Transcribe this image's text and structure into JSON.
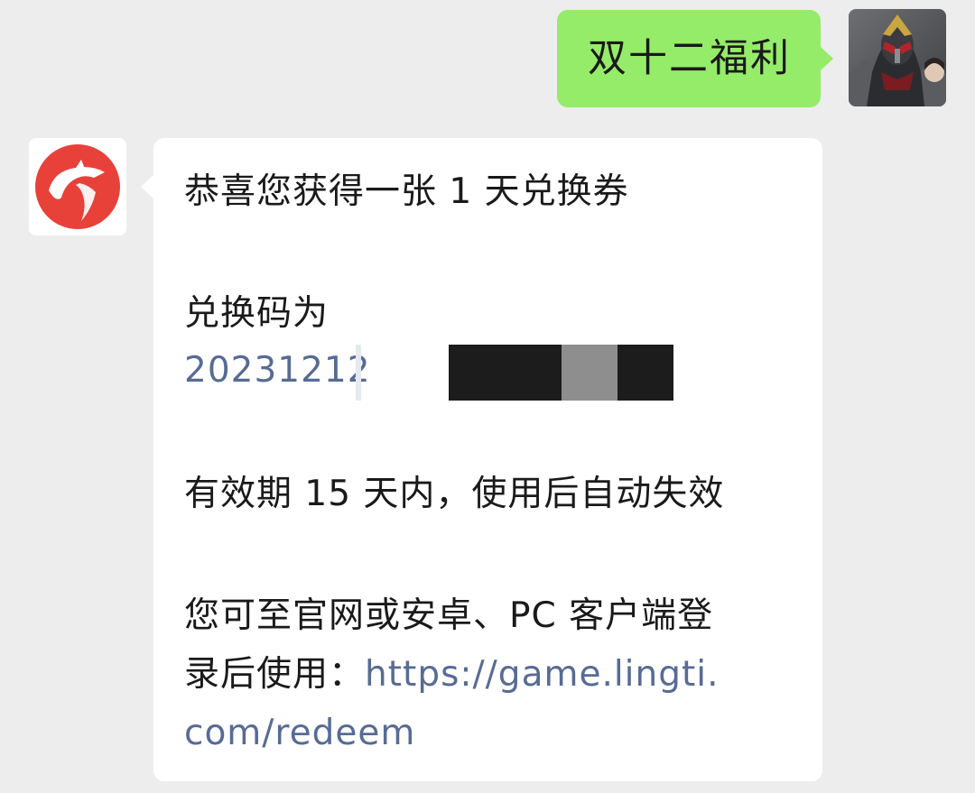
{
  "conversation": {
    "outgoing": {
      "text": "双十二福利"
    },
    "incoming": {
      "line_1": "恭喜您获得一张 1 天兑换券",
      "code_label": "兑换码为",
      "code_visible": "20231212",
      "validity": "有效期 15 天内，使用后自动失效",
      "instructions_line_1": "您可至官网或安卓、PC 客户端登",
      "instructions_line_2_prefix": "录后使用：",
      "link_part_1": "https://game.lingti.",
      "link_part_2": "com/redeem"
    }
  },
  "colors": {
    "chat_background": "#ededed",
    "outgoing_bubble": "#95ec69",
    "incoming_bubble": "#ffffff",
    "link": "#576b95",
    "text": "#1a1a1a",
    "bot_logo_red": "#e8413a"
  },
  "icons": {
    "self_avatar": "masked-rider-avatar",
    "bot_avatar": "lingti-logo-icon"
  }
}
